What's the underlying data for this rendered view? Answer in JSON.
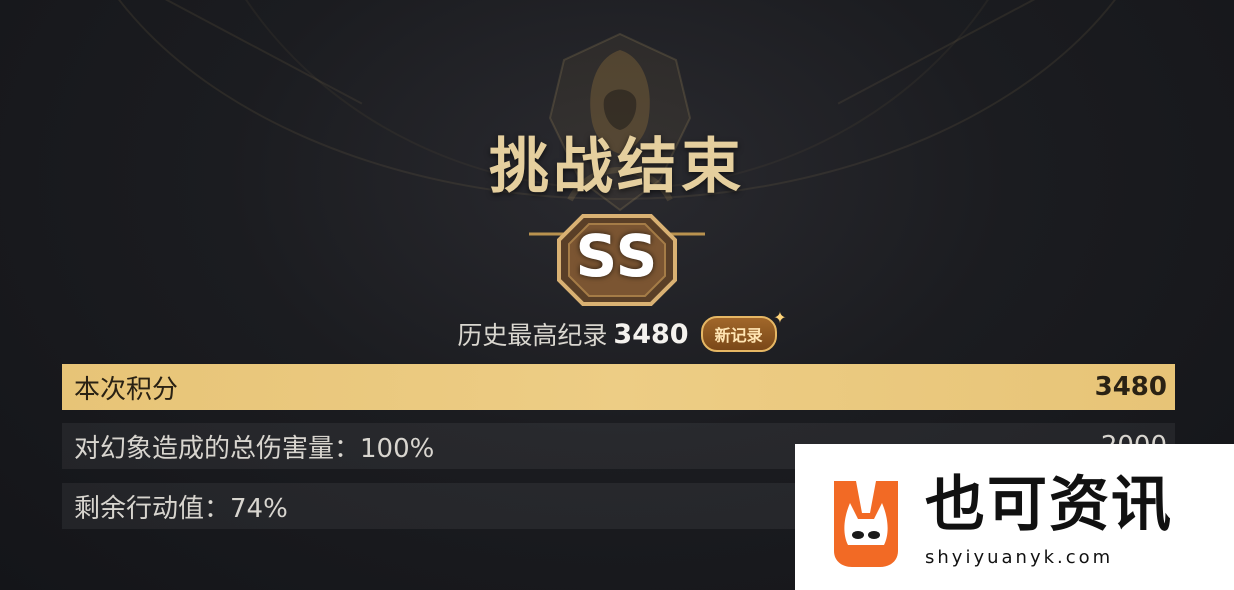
{
  "header": {
    "title": "挑战结束"
  },
  "rank": {
    "grade": "SS"
  },
  "record": {
    "label": "历史最高纪录",
    "value": "3480",
    "badge": "新记录"
  },
  "rows": [
    {
      "label": "本次积分",
      "value": "3480"
    },
    {
      "label": "对幻象造成的总伤害量：100%",
      "value": "2000"
    },
    {
      "label": "剩余行动值：74%",
      "value": ""
    }
  ],
  "watermark": {
    "name": "也可资讯",
    "url": "shyiyuanyk.com"
  },
  "colors": {
    "gold": "#e5cf9e",
    "highlight": "#e7c477",
    "badge_border": "#e6b764",
    "logo_orange": "#f26a25"
  }
}
